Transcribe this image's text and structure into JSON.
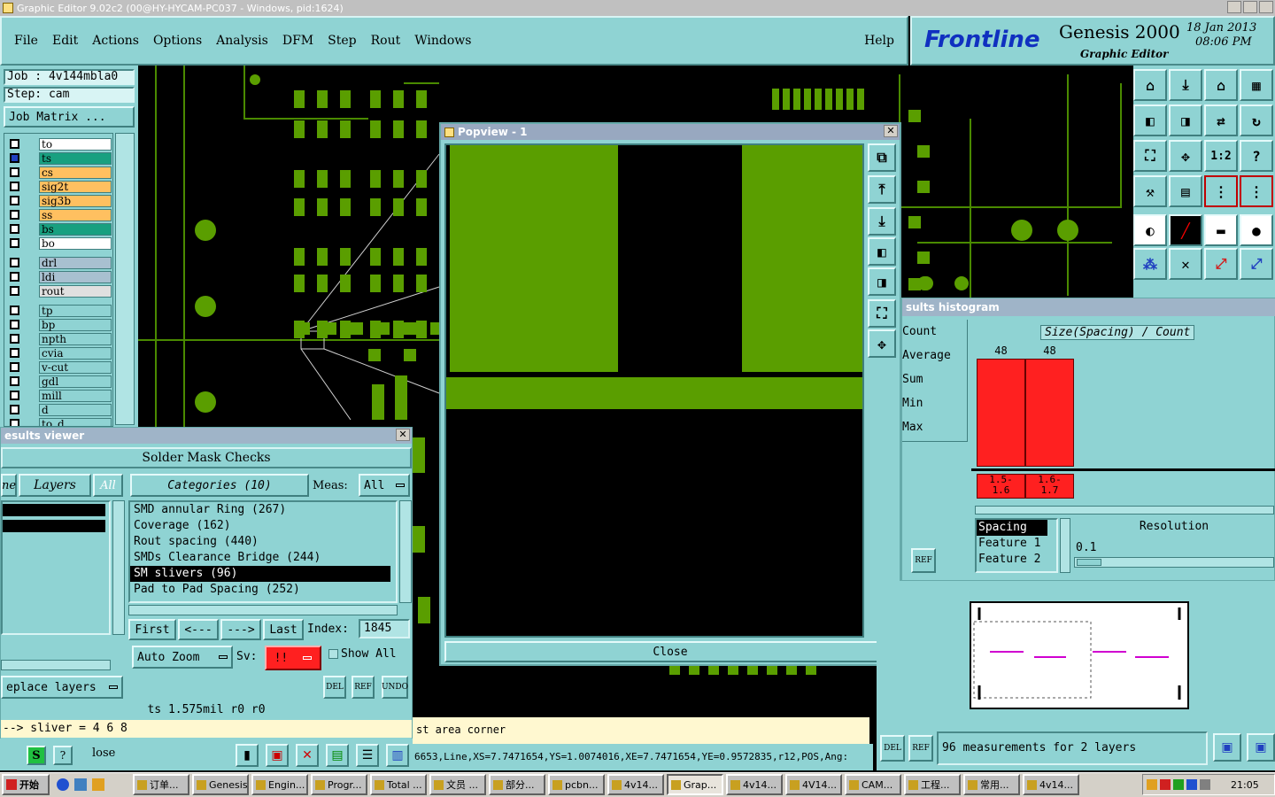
{
  "window_title": "Graphic Editor 9.02c2 (00@HY-HYCAM-PC037 - Windows, pid:1624)",
  "menu": [
    "File",
    "Edit",
    "Actions",
    "Options",
    "Analysis",
    "DFM",
    "Step",
    "Rout",
    "Windows"
  ],
  "help_label": "Help",
  "brand": {
    "logo": "Frontline",
    "product": "Genesis 2000",
    "subtitle": "Graphic Editor",
    "date": "18 Jan 2013",
    "time": "08:06 PM"
  },
  "job": {
    "job_label": "Job : 4v144mbla0",
    "step_label": "Step: cam",
    "matrix_button": "Job Matrix ..."
  },
  "layers": [
    {
      "name": "to",
      "color": "#ffffff"
    },
    {
      "name": "ts",
      "color": "#18a080"
    },
    {
      "name": "cs",
      "color": "#ffc060"
    },
    {
      "name": "sig2t",
      "color": "#ffc060"
    },
    {
      "name": "sig3b",
      "color": "#ffc060"
    },
    {
      "name": "ss",
      "color": "#ffc060"
    },
    {
      "name": "bs",
      "color": "#18a080"
    },
    {
      "name": "bo",
      "color": "#ffffff"
    },
    {
      "name": "drl",
      "color": "#a8c0d0"
    },
    {
      "name": "ldi",
      "color": "#a8c0d0"
    },
    {
      "name": "rout",
      "color": "#e0e0e0"
    },
    {
      "name": "tp",
      "color": "#8fd3d3"
    },
    {
      "name": "bp",
      "color": "#8fd3d3"
    },
    {
      "name": "npth",
      "color": "#8fd3d3"
    },
    {
      "name": "cvia",
      "color": "#8fd3d3"
    },
    {
      "name": "v-cut",
      "color": "#8fd3d3"
    },
    {
      "name": "gdl",
      "color": "#8fd3d3"
    },
    {
      "name": "mill",
      "color": "#8fd3d3"
    },
    {
      "name": "d",
      "color": "#8fd3d3"
    },
    {
      "name": "to_d",
      "color": "#8fd3d3"
    }
  ],
  "popview": {
    "title": "Popview - 1",
    "close_label": "Close"
  },
  "results_viewer": {
    "title": "esults viewer",
    "heading": "Solder Mask Checks",
    "ne_label": "ne",
    "layers_label": "Layers",
    "all_label": "All",
    "categories_label": "Categories (10)",
    "meas_label": "Meas:",
    "meas_value": "All",
    "categories": [
      "SMD annular Ring (267)",
      "Coverage (162)",
      "Rout spacing (440)",
      "SMDs Clearance Bridge (244)",
      "SM slivers (96)",
      "Pad to Pad Spacing (252)"
    ],
    "selected_category": "SM slivers (96)",
    "first": "First",
    "prev": "<---",
    "next": "--->",
    "last": "Last",
    "index_label": "Index:",
    "index_value": "1845",
    "auto_zoom": "Auto Zoom",
    "sv_label": "Sv:",
    "sv_value": "!!",
    "show_all": "Show All",
    "replace_layers": "eplace layers",
    "del": "DEL",
    "ref": "REF",
    "undo": "UNDO"
  },
  "status": {
    "info": "ts 1.575mil  r0  r0",
    "sliver": "--> sliver = 4 6 8",
    "close_label": "lose",
    "area_corner": "st area corner",
    "coord_line": "6653,Line,XS=7.7471654,YS=1.0074016,XE=7.7471654,YE=0.9572835,r12,POS,Ang:"
  },
  "histogram": {
    "title": "sults histogram",
    "stats": [
      "Count",
      "Average",
      "Sum",
      "Min",
      "Max"
    ],
    "chart_title": "Size(Spacing) / Count",
    "bars": [
      {
        "count": "48",
        "label": "1.5-\n1.6"
      },
      {
        "count": "48",
        "label": "1.6-\n1.7"
      }
    ],
    "bar_color": "#ff2020",
    "options": [
      "Spacing",
      "Feature 1",
      "Feature 2"
    ],
    "selected_option": "Spacing",
    "resolution_label": "Resolution",
    "resolution_value": "0.1",
    "ref": "REF",
    "del": "DEL",
    "measurement_summary": "96 measurements for 2 layers"
  },
  "taskbar": {
    "start": "开始",
    "items": [
      "订单...",
      "Genesis",
      "Engin...",
      "Progr...",
      "Total ...",
      "文员 ...",
      "部分...",
      "pcbn...",
      "4v14...",
      "Grap...",
      "4v14...",
      "4V14...",
      "CAM...",
      "工程...",
      "常用...",
      "4v14..."
    ],
    "clock": "21:05"
  }
}
